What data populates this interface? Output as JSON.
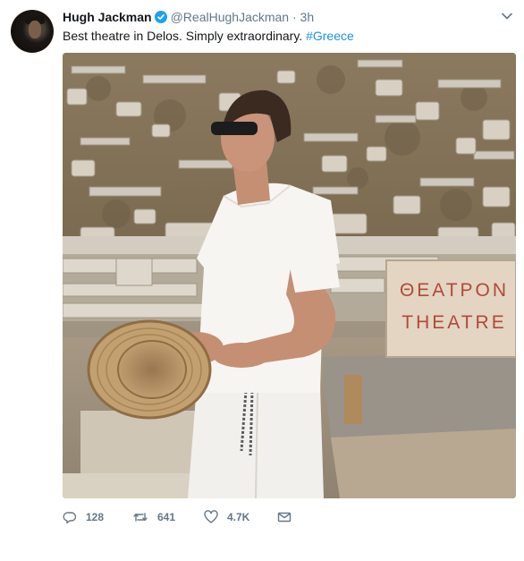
{
  "tweet": {
    "author_name": "Hugh Jackman",
    "handle": "@RealHughJackman",
    "separator": "·",
    "time": "3h",
    "text": "Best theatre in Delos. Simply extraordinary. ",
    "hashtag": "#Greece",
    "verified": true
  },
  "photo": {
    "sign_line1": "ΘΕΑΤΡΟΝ",
    "sign_line2": "THEATRE"
  },
  "actions": {
    "reply_count": "128",
    "retweet_count": "641",
    "like_count": "4.7K"
  },
  "icons": {
    "avatar": "avatar",
    "verified": "verified-badge-icon",
    "menu": "chevron-down-icon",
    "reply": "reply-icon",
    "retweet": "retweet-icon",
    "like": "heart-icon",
    "message": "envelope-icon"
  },
  "colors": {
    "link": "#1b95e0",
    "verified": "#1da1f2",
    "muted": "#657786",
    "text": "#14171a"
  }
}
